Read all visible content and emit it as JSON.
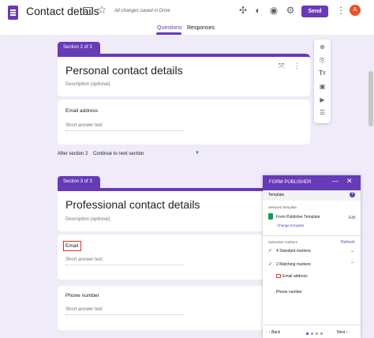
{
  "header": {
    "title": "Contact details",
    "saved_status": "All changes saved in Drive",
    "send_label": "Send",
    "avatar_letter": "A",
    "icons": [
      "folder-icon",
      "star-icon",
      "addon-icon",
      "palette-icon",
      "preview-icon",
      "settings-icon",
      "more-icon"
    ]
  },
  "tabs": [
    {
      "label": "Questions",
      "active": true
    },
    {
      "label": "Responses",
      "active": false
    }
  ],
  "sections": [
    {
      "tag": "Section 2 of 3",
      "title": "Personal contact details",
      "description": "Description (optional)",
      "questions": [
        {
          "label": "Email address",
          "answer": "Short answer text"
        }
      ]
    },
    {
      "tag": "Section 3 of 3",
      "title": "Professional contact details",
      "description": "Description (optional)",
      "questions": [
        {
          "label": "Email",
          "answer": "Short answer text"
        },
        {
          "label": "Phone number",
          "answer": "Short answer text"
        }
      ]
    }
  ],
  "after_section": {
    "label": "After section 2",
    "value": "Continue to next section"
  },
  "toolbar": [
    "add-question-icon",
    "import-questions-icon",
    "add-title-icon",
    "add-image-icon",
    "add-video-icon",
    "add-section-icon"
  ],
  "panel": {
    "title": "FORM PUBLISHER",
    "tab": "Template",
    "selected_template_label": "Selected template",
    "template_name": "Form Publisher Template",
    "edit_label": "Edit",
    "change_template_label": "Change template",
    "operative_markers_label": "Operative markers",
    "refresh_label": "Refresh",
    "standard_markers": "4 Standard markers",
    "matching_markers": "2 Matching markers",
    "marker_items": [
      "Email address",
      "Phone number"
    ],
    "back_label": "Back",
    "next_label": "Next",
    "page_dots": 4,
    "active_dot": 1
  },
  "colors": {
    "accent": "#673ab7",
    "background": "#f0ebf8",
    "check": "#0f9d58",
    "highlight": "#d93025"
  }
}
